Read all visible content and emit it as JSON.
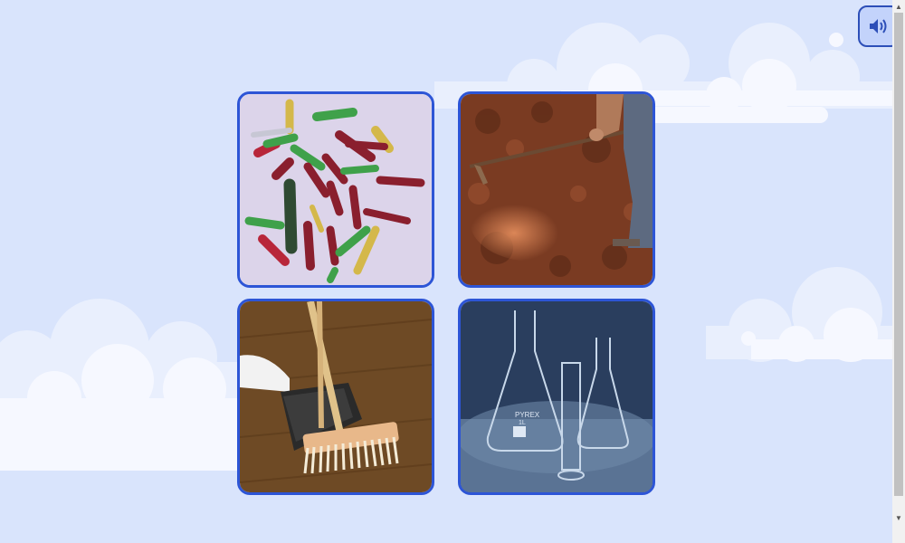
{
  "toolbar": {
    "sound_icon": "speaker-volume-icon"
  },
  "options": [
    {
      "id": "wall-plugs",
      "image": "colorful-plastic-wall-anchors"
    },
    {
      "id": "hoeing-soil",
      "image": "person-hoeing-red-soil"
    },
    {
      "id": "broom-dustpan",
      "image": "broom-and-dustpan-on-floor"
    },
    {
      "id": "lab-glassware",
      "image": "erlenmeyer-flasks-and-graduated-cylinder"
    }
  ],
  "colors": {
    "background": "#d9e4fc",
    "card_border": "#2d55d6",
    "button_border": "#2d4fb8"
  }
}
